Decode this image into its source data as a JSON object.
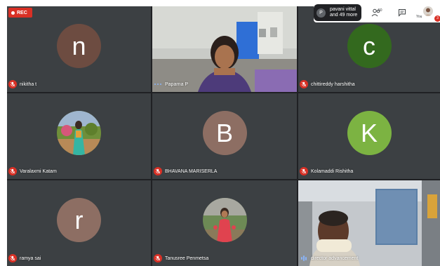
{
  "rec": {
    "label": "REC"
  },
  "top_bar": {
    "participants_avatar_initial": "P",
    "participants_line1": "pavani vittal",
    "participants_line2": "and 49 more",
    "people_count": "50",
    "self_label": "You",
    "badge_count": "3"
  },
  "tiles": [
    {
      "name": "nikitha t",
      "initial": "n",
      "color": "#6d4c41",
      "muted": true
    },
    {
      "name": "Paparna P",
      "muted": false,
      "video": true
    },
    {
      "name": "chittireddy harshitha",
      "initial": "c",
      "color": "#33691e",
      "muted": true
    },
    {
      "name": "Varalaxmi Katam",
      "muted": true,
      "photo": true
    },
    {
      "name": "BHAVANA MARISERLA",
      "initial": "B",
      "color": "#8d6e63",
      "muted": true
    },
    {
      "name": "Kolamaddi Rishitha",
      "initial": "K",
      "color": "#7cb342",
      "muted": true
    },
    {
      "name": "ramya sai",
      "initial": "r",
      "color": "#8d6e63",
      "muted": true
    },
    {
      "name": "Tanusree Penmetsa",
      "muted": true,
      "photo": true
    },
    {
      "name": "director advancement",
      "muted": false,
      "video": true,
      "speaking": true
    }
  ],
  "colors": {
    "grid_bg": "#202124",
    "tile_bg": "#3c4043",
    "mic_red": "#d93025",
    "accent_blue": "#8ab4f8"
  }
}
